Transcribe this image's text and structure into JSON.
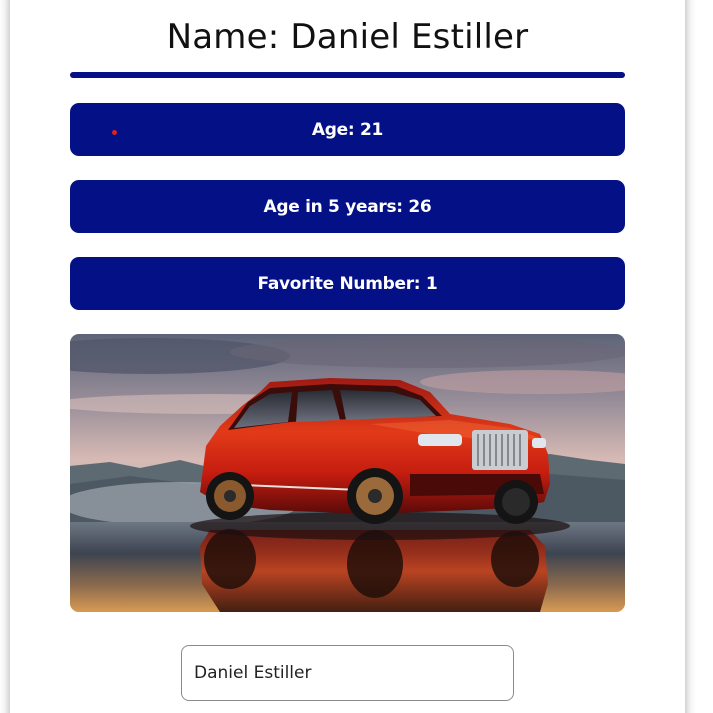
{
  "profile": {
    "title": "Name: Daniel Estiller",
    "age_label": "Age: 21",
    "age_in_5_label": "Age in 5 years: 26",
    "favorite_number_label": "Favorite Number: 1"
  },
  "image": {
    "subject": "red luxury SUV on reflective water at sunset"
  },
  "form": {
    "name_value": "Daniel Estiller"
  },
  "colors": {
    "accent": "#041085",
    "text_on_accent": "#ffffff",
    "marker_dot": "#e0201a"
  },
  "icons": {
    "marker": "red-dot-indicator"
  }
}
